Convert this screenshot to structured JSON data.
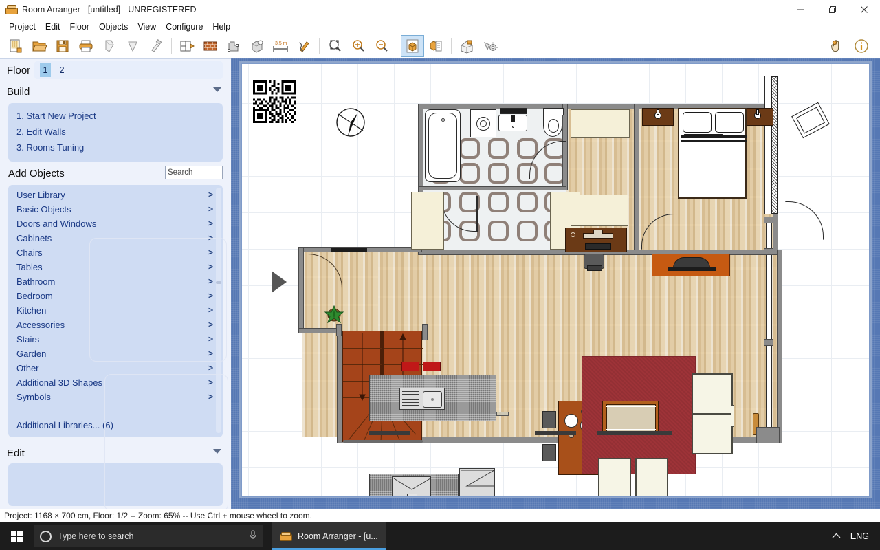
{
  "window": {
    "title": "Room Arranger - [untitled] - UNREGISTERED",
    "app_icon": "sofa-icon",
    "minimize": "minimize-icon",
    "maximize": "restore-icon",
    "close": "close-icon"
  },
  "menu": {
    "items": [
      {
        "label": "Project"
      },
      {
        "label": "Edit"
      },
      {
        "label": "Floor"
      },
      {
        "label": "Objects"
      },
      {
        "label": "View"
      },
      {
        "label": "Configure"
      },
      {
        "label": "Help"
      }
    ]
  },
  "toolbar": {
    "groups": [
      {
        "buttons": [
          {
            "name": "new-project-icon",
            "label": "New"
          },
          {
            "name": "open-project-icon",
            "label": "Open"
          },
          {
            "name": "save-project-icon",
            "label": "Save"
          },
          {
            "name": "print-icon",
            "label": "Print"
          },
          {
            "name": "copy-icon",
            "label": "Copy"
          },
          {
            "name": "paste-icon",
            "label": "Paste"
          },
          {
            "name": "format-painter-icon",
            "label": "Format Painter"
          }
        ]
      },
      {
        "buttons": [
          {
            "name": "room-plan-icon",
            "label": "Rooms Tuning"
          },
          {
            "name": "wall-brick-icon",
            "label": "Edit Walls"
          },
          {
            "name": "polygon-select-icon",
            "label": "Shape"
          },
          {
            "name": "object-3d-icon",
            "label": "Object"
          },
          {
            "name": "measure-icon",
            "label": "Measure 3.5 m"
          },
          {
            "name": "pencil-ruler-icon",
            "label": "Draw"
          }
        ]
      },
      {
        "buttons": [
          {
            "name": "zoom-fit-icon",
            "label": "Zoom to Fit"
          },
          {
            "name": "zoom-in-icon",
            "label": "Zoom In"
          },
          {
            "name": "zoom-out-icon",
            "label": "Zoom Out"
          }
        ]
      },
      {
        "buttons": [
          {
            "name": "view-3d-box-icon",
            "label": "3D View",
            "active": true
          },
          {
            "name": "view-multi-icon",
            "label": "Multiple Views"
          }
        ]
      },
      {
        "buttons": [
          {
            "name": "house-3d-icon",
            "label": "Render House"
          },
          {
            "name": "effects-icon",
            "label": "Effects"
          }
        ]
      }
    ],
    "right_buttons": [
      {
        "name": "pan-hand-icon",
        "label": "Pan"
      },
      {
        "name": "info-icon",
        "label": "Info"
      }
    ],
    "measure_label": "3.5 m"
  },
  "sidebar": {
    "floor": {
      "title": "Floor",
      "tabs": [
        {
          "label": "1",
          "selected": true
        },
        {
          "label": "2",
          "selected": false
        }
      ]
    },
    "build": {
      "title": "Build",
      "collapse_icon": "collapse-triangle-icon",
      "items": [
        {
          "label": "1. Start New Project"
        },
        {
          "label": "2. Edit Walls"
        },
        {
          "label": "3. Rooms Tuning"
        }
      ]
    },
    "add_objects": {
      "title": "Add Objects",
      "search_placeholder": "Search",
      "search_value": "",
      "items": [
        {
          "label": "User Library",
          "chevron": ">"
        },
        {
          "label": "Basic Objects",
          "chevron": ">"
        },
        {
          "label": "Doors and Windows",
          "chevron": ">"
        },
        {
          "label": "Cabinets",
          "chevron": ">"
        },
        {
          "label": "Chairs",
          "chevron": ">"
        },
        {
          "label": "Tables",
          "chevron": ">"
        },
        {
          "label": "Bathroom",
          "chevron": ">"
        },
        {
          "label": "Bedroom",
          "chevron": ">"
        },
        {
          "label": "Kitchen",
          "chevron": ">"
        },
        {
          "label": "Accessories",
          "chevron": ">"
        },
        {
          "label": "Stairs",
          "chevron": ">"
        },
        {
          "label": "Garden",
          "chevron": ">"
        },
        {
          "label": "Other",
          "chevron": ">"
        },
        {
          "label": "Additional 3D Shapes",
          "chevron": ">"
        },
        {
          "label": "Symbols",
          "chevron": ">"
        }
      ],
      "additional_libraries": "Additional Libraries... (6)"
    },
    "edit": {
      "title": "Edit",
      "collapse_icon": "collapse-triangle-icon"
    }
  },
  "canvas": {
    "expand_handle_icon": "expand-triangle-icon",
    "qr_code_icon": "qr-code-icon",
    "compass_icon": "compass-north-icon",
    "project_width_cm": 1168,
    "project_height_cm": 700,
    "zoom_percent": 65
  },
  "statusbar": {
    "text": "Project: 1168 × 700 cm, Floor: 1/2 -- Zoom: 65% -- Use Ctrl + mouse wheel to zoom."
  },
  "taskbar": {
    "start_icon": "windows-start-icon",
    "search_placeholder": "Type here to search",
    "search_circle_icon": "cortana-circle-icon",
    "mic_icon": "microphone-icon",
    "tasks": [
      {
        "label": "Room Arranger - [u...",
        "icon": "sofa-icon",
        "active": true
      }
    ],
    "tray": {
      "chevron_icon": "chevron-up-icon",
      "language": "ENG"
    }
  },
  "colors": {
    "accent_blue": "#5678b4",
    "panel_bg": "#eef2fb",
    "card_bg": "#cfdcf3",
    "link_text": "#1b3a86",
    "rug_red": "#9e3338",
    "wood_orange": "#a84f15",
    "taskbar_bg": "#1c1c1c"
  }
}
